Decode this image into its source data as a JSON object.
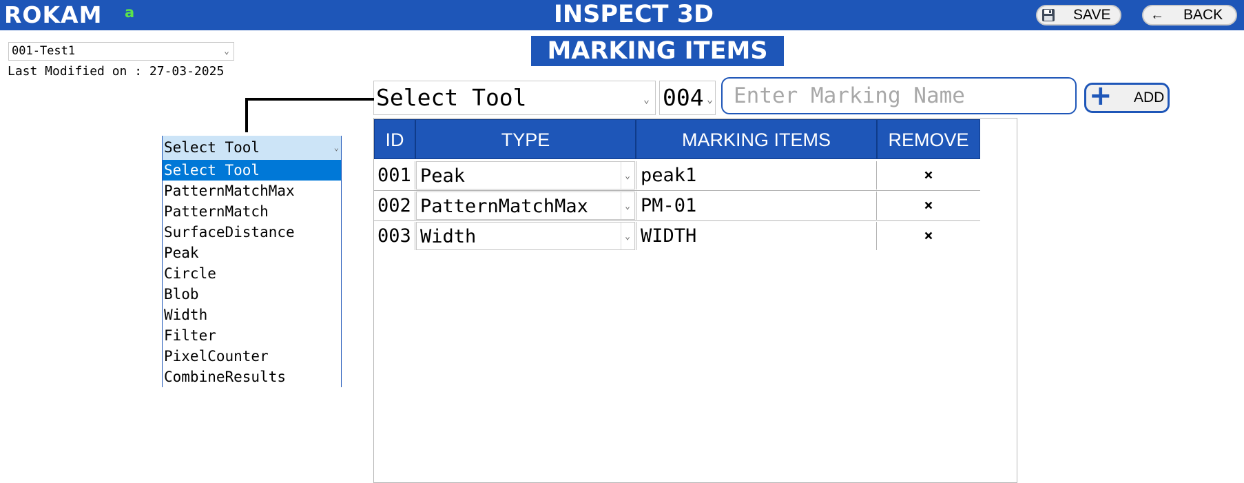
{
  "header": {
    "logo": "ROKAM",
    "user_indicator": "a",
    "title": "INSPECT 3D",
    "save_label": "SAVE",
    "back_label": "BACK",
    "back_arrow": "←",
    "bar_color": "#1e56b8"
  },
  "recipe": {
    "selected": "001-Test1",
    "last_modified_label": "Last Modified on : ",
    "last_modified_date": "27-03-2025"
  },
  "page_title": "MARKING ITEMS",
  "add_form": {
    "tool_selected": "Select Tool",
    "next_id": "004",
    "name_placeholder": "Enter Marking Name",
    "add_label": "ADD",
    "add_icon": "+"
  },
  "tool_dropdown": {
    "current": "Select Tool",
    "options": [
      "Select Tool",
      "PatternMatchMax",
      "PatternMatch",
      "SurfaceDistance",
      "Peak",
      "Circle",
      "Blob",
      "Width",
      "Filter",
      "PixelCounter",
      "CombineResults"
    ],
    "highlighted_index": 0,
    "highlight_color": "#0078d7"
  },
  "table": {
    "headers": [
      "ID",
      "TYPE",
      "MARKING ITEMS",
      "REMOVE"
    ],
    "rows": [
      {
        "id": "001",
        "type": "Peak",
        "name": "peak1",
        "remove": "×"
      },
      {
        "id": "002",
        "type": "PatternMatchMax",
        "name": "PM-01",
        "remove": "×"
      },
      {
        "id": "003",
        "type": "Width",
        "name": "WIDTH",
        "remove": "×"
      }
    ]
  }
}
